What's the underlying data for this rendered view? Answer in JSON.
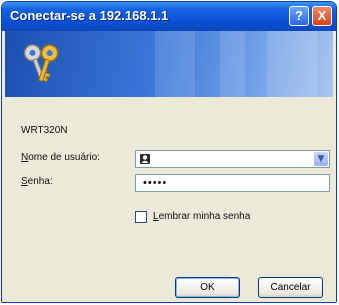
{
  "window": {
    "title": "Conectar-se a 192.168.1.1",
    "help_glyph": "?",
    "close_glyph": "X",
    "banner_icon": "keys-icon"
  },
  "dialog": {
    "server_name": "WRT320N",
    "username": {
      "label_first": "N",
      "label_rest": "ome de usuário:",
      "value": "",
      "icon": "user-icon"
    },
    "password": {
      "label_first": "S",
      "label_rest": "enha:",
      "value": "•••••"
    },
    "remember": {
      "label_first": "L",
      "label_rest": "embrar minha senha",
      "checked": false
    },
    "buttons": {
      "ok": "OK",
      "cancel": "Cancelar"
    }
  }
}
